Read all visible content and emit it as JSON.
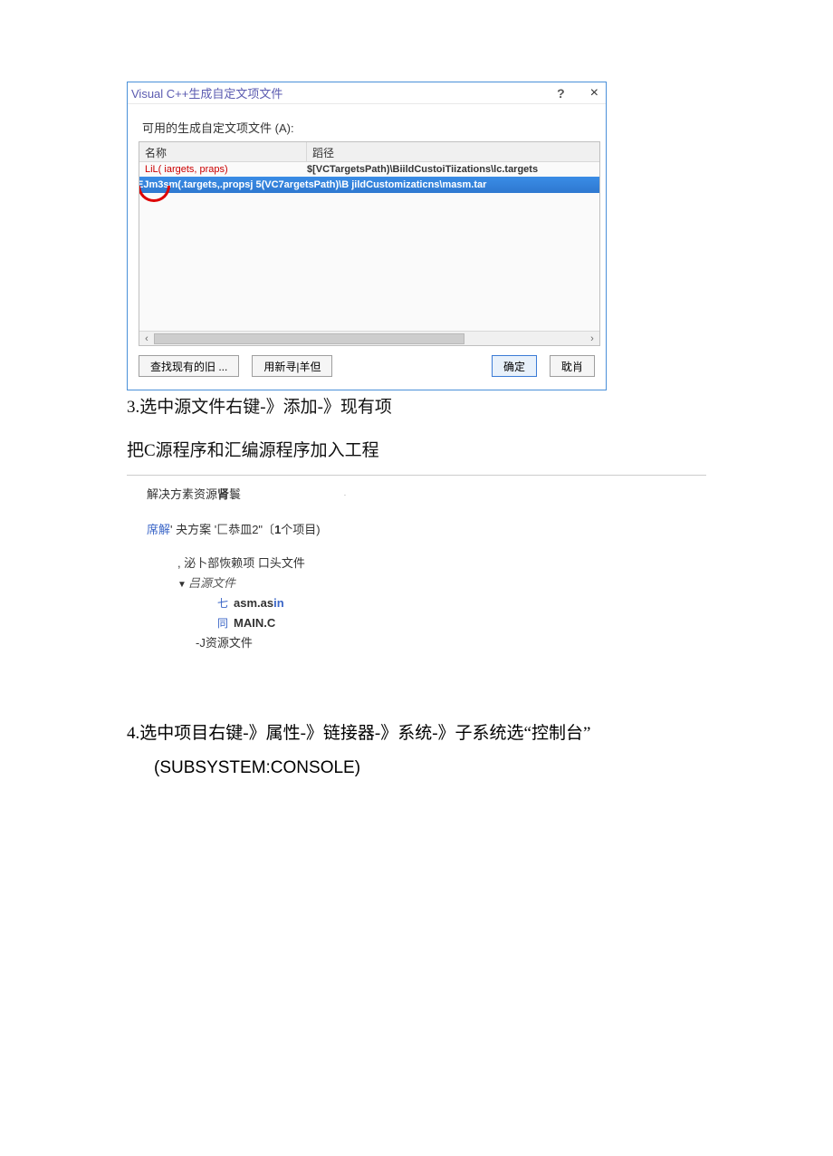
{
  "dialog": {
    "title": "Visual C++生成自定文项文件",
    "helpGlyph": "?",
    "closeGlyph": "×",
    "available_label": "可用的生成自定文项文件 (A):",
    "headers": {
      "name": "名称",
      "path": "蹈径"
    },
    "row1": {
      "name": "LiL( iargets, praps)",
      "path": "$[VCTargetsPath)\\BiildCustoiTiizations\\lc.targets"
    },
    "row_selected": "jEJm3sm(.targets,.propsj 5(VC7argetsPath)\\B jildCustomizaticns\\masm.tar",
    "scroll": {
      "left": "‹",
      "right": "›"
    },
    "buttons": {
      "find": "查找现有的旧 ...",
      "refresh": "用新寻|羊但",
      "ok": "确定",
      "cancel": "耽肖"
    }
  },
  "doc": {
    "step3": "3.选中源文件右键-》添加-》现有项",
    "step3_sub": "把C源程序和汇编源程序加入工程",
    "solution": {
      "title_prefix": "解决方素资源",
      "title_bold": "肾",
      "title_suffix": "鬟",
      "line_prefix": "席解",
      "line_mid": "' 夬方案  '匚恭皿2\"〔",
      "line_bold": "1",
      "line_suffix": "个项目)",
      "ext_deps": ",  泌卜部恢赖项  口头文件",
      "src_folder_tri": "▼",
      "src_folder": "吕源文件",
      "file1_icon": "七",
      "file1": "asm.as",
      "file1_suffix": "in",
      "file2_icon": "同",
      "file2": "MAIN.C",
      "res_folder": "-J资源文件"
    },
    "step4": "4.选中项目右键-》属性-》链接器-》系统-》子系统选“控制台”",
    "subsystem": "(SUBSYSTEM:CONSOLE)"
  }
}
